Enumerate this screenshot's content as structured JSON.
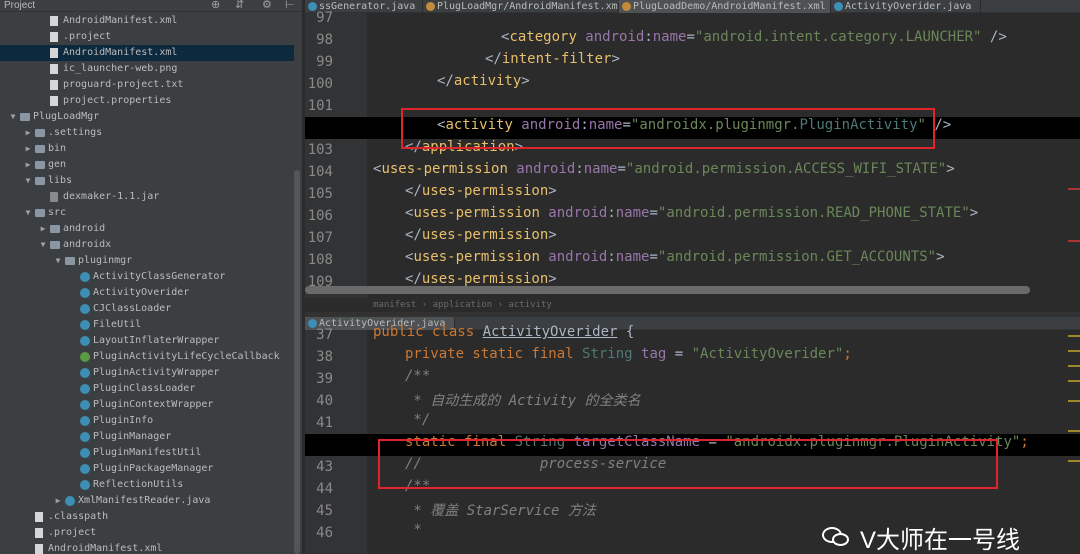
{
  "sidebar": {
    "header": "Project",
    "rows": [
      {
        "label": "AndroidManifest.xml",
        "indent": 3,
        "icon": "xml-file-icon",
        "arrow": ""
      },
      {
        "label": ".project",
        "indent": 3,
        "icon": "file-icon",
        "arrow": ""
      },
      {
        "label": "AndroidManifest.xml",
        "indent": 3,
        "icon": "xml-file-icon",
        "arrow": "",
        "selected": true
      },
      {
        "label": "ic_launcher-web.png",
        "indent": 3,
        "icon": "image-file-icon",
        "arrow": ""
      },
      {
        "label": "proguard-project.txt",
        "indent": 3,
        "icon": "text-file-icon",
        "arrow": ""
      },
      {
        "label": "project.properties",
        "indent": 3,
        "icon": "properties-file-icon",
        "arrow": ""
      },
      {
        "label": "PlugLoadMgr",
        "indent": 1,
        "icon": "folder-icon",
        "arrow": "▼"
      },
      {
        "label": ".settings",
        "indent": 2,
        "icon": "folder-icon",
        "arrow": "▶"
      },
      {
        "label": "bin",
        "indent": 2,
        "icon": "folder-icon",
        "arrow": "▶"
      },
      {
        "label": "gen",
        "indent": 2,
        "icon": "folder-icon",
        "arrow": "▶"
      },
      {
        "label": "libs",
        "indent": 2,
        "icon": "folder-icon",
        "arrow": "▼"
      },
      {
        "label": "dexmaker-1.1.jar",
        "indent": 3,
        "icon": "jar-icon",
        "arrow": ""
      },
      {
        "label": "src",
        "indent": 2,
        "icon": "folder-icon",
        "arrow": "▼"
      },
      {
        "label": "android",
        "indent": 3,
        "icon": "package-icon",
        "arrow": "▶"
      },
      {
        "label": "androidx",
        "indent": 3,
        "icon": "package-icon",
        "arrow": "▼"
      },
      {
        "label": "pluginmgr",
        "indent": 4,
        "icon": "package-icon",
        "arrow": "▼"
      },
      {
        "label": "ActivityClassGenerator",
        "indent": 5,
        "icon": "class-icon",
        "arrow": ""
      },
      {
        "label": "ActivityOverider",
        "indent": 5,
        "icon": "class-icon",
        "arrow": ""
      },
      {
        "label": "CJClassLoader",
        "indent": 5,
        "icon": "class-icon",
        "arrow": ""
      },
      {
        "label": "FileUtil",
        "indent": 5,
        "icon": "class-icon",
        "arrow": ""
      },
      {
        "label": "LayoutInflaterWrapper",
        "indent": 5,
        "icon": "class-icon",
        "arrow": ""
      },
      {
        "label": "PluginActivityLifeCycleCallback",
        "indent": 5,
        "icon": "interface-icon",
        "arrow": ""
      },
      {
        "label": "PluginActivityWrapper",
        "indent": 5,
        "icon": "class-icon",
        "arrow": ""
      },
      {
        "label": "PluginClassLoader",
        "indent": 5,
        "icon": "class-icon",
        "arrow": ""
      },
      {
        "label": "PluginContextWrapper",
        "indent": 5,
        "icon": "class-icon",
        "arrow": ""
      },
      {
        "label": "PluginInfo",
        "indent": 5,
        "icon": "class-icon",
        "arrow": ""
      },
      {
        "label": "PluginManager",
        "indent": 5,
        "icon": "class-icon",
        "arrow": ""
      },
      {
        "label": "PluginManifestUtil",
        "indent": 5,
        "icon": "class-icon",
        "arrow": ""
      },
      {
        "label": "PluginPackageManager",
        "indent": 5,
        "icon": "class-icon",
        "arrow": ""
      },
      {
        "label": "ReflectionUtils",
        "indent": 5,
        "icon": "class-icon",
        "arrow": ""
      },
      {
        "label": "XmlManifestReader.java",
        "indent": 4,
        "icon": "class-icon",
        "arrow": "▶"
      },
      {
        "label": ".classpath",
        "indent": 2,
        "icon": "file-icon",
        "arrow": ""
      },
      {
        "label": ".project",
        "indent": 2,
        "icon": "file-icon",
        "arrow": ""
      },
      {
        "label": "AndroidManifest.xml",
        "indent": 2,
        "icon": "xml-file-icon",
        "arrow": ""
      }
    ]
  },
  "editor_top": {
    "tabs": [
      {
        "label": "ssGenerator.java",
        "active": false
      },
      {
        "label": "PlugLoadMgr/AndroidManifest.xml",
        "active": false
      },
      {
        "label": "PlugLoadDemo/AndroidManifest.xml",
        "active": true
      },
      {
        "label": "ActivityOverider.java",
        "active": false
      }
    ],
    "lines": [
      {
        "n": "97",
        "indent": 0,
        "parts": []
      },
      {
        "n": "98",
        "indent": 8,
        "parts": [
          [
            "tx",
            "<"
          ],
          [
            "tg",
            "category "
          ],
          [
            "at",
            "android"
          ],
          [
            "tx",
            ":"
          ],
          [
            "fl",
            "name"
          ],
          [
            "tx",
            "="
          ],
          [
            "st",
            "\"android.intent.category.LAUNCHER\""
          ],
          [
            "tx",
            " />"
          ]
        ]
      },
      {
        "n": "99",
        "indent": 7,
        "parts": [
          [
            "tx",
            "</"
          ],
          [
            "tg",
            "intent-filter"
          ],
          [
            "tx",
            ">"
          ]
        ]
      },
      {
        "n": "100",
        "indent": 4,
        "parts": [
          [
            "tx",
            "</"
          ],
          [
            "tg",
            "activity"
          ],
          [
            "tx",
            ">"
          ]
        ]
      },
      {
        "n": "101",
        "indent": 0,
        "parts": []
      },
      {
        "n": "102",
        "indent": 4,
        "cur": true,
        "parts": [
          [
            "tx",
            "<"
          ],
          [
            "tg",
            "activity "
          ],
          [
            "at",
            "android"
          ],
          [
            "tx",
            ":"
          ],
          [
            "fl",
            "name"
          ],
          [
            "tx",
            "="
          ],
          [
            "st",
            "\"androidx."
          ],
          [
            "st",
            "pluginmgr"
          ],
          [
            "st",
            "."
          ],
          [
            "tp",
            "PluginActivity"
          ],
          [
            "st",
            "\""
          ],
          [
            "tx",
            " />"
          ]
        ]
      },
      {
        "n": "103",
        "indent": 2,
        "parts": [
          [
            "tx",
            "</"
          ],
          [
            "tg",
            "application"
          ],
          [
            "tx",
            ">"
          ]
        ]
      },
      {
        "n": "104",
        "indent": 0,
        "parts": [
          [
            "tx",
            "<"
          ],
          [
            "tg",
            "uses-permission "
          ],
          [
            "at",
            "android"
          ],
          [
            "tx",
            ":"
          ],
          [
            "fl",
            "name"
          ],
          [
            "tx",
            "="
          ],
          [
            "st",
            "\"android.permission.ACCESS_WIFI_STATE\""
          ],
          [
            "tx",
            ">"
          ]
        ]
      },
      {
        "n": "105",
        "indent": 2,
        "parts": [
          [
            "tx",
            "</"
          ],
          [
            "tg",
            "uses-permission"
          ],
          [
            "tx",
            ">"
          ]
        ]
      },
      {
        "n": "106",
        "indent": 2,
        "parts": [
          [
            "tx",
            "<"
          ],
          [
            "tg",
            "uses-permission "
          ],
          [
            "at",
            "android"
          ],
          [
            "tx",
            ":"
          ],
          [
            "fl",
            "name"
          ],
          [
            "tx",
            "="
          ],
          [
            "st",
            "\"android.permission.READ_PHONE_STATE\""
          ],
          [
            "tx",
            ">"
          ]
        ]
      },
      {
        "n": "107",
        "indent": 2,
        "parts": [
          [
            "tx",
            "</"
          ],
          [
            "tg",
            "uses-permission"
          ],
          [
            "tx",
            ">"
          ]
        ]
      },
      {
        "n": "108",
        "indent": 2,
        "parts": [
          [
            "tx",
            "<"
          ],
          [
            "tg",
            "uses-permission "
          ],
          [
            "at",
            "android"
          ],
          [
            "tx",
            ":"
          ],
          [
            "fl",
            "name"
          ],
          [
            "tx",
            "="
          ],
          [
            "st",
            "\"android.permission.GET_ACCOUNTS\""
          ],
          [
            "tx",
            ">"
          ]
        ]
      },
      {
        "n": "109",
        "indent": 2,
        "parts": [
          [
            "tx",
            "</"
          ],
          [
            "tg",
            "uses-permission"
          ],
          [
            "tx",
            ">"
          ]
        ]
      }
    ]
  },
  "breadcrumb": "manifest › application › activity",
  "editor_bottom": {
    "tabs": [
      {
        "label": "ActivityOverider.java",
        "active": true
      }
    ],
    "lines": [
      {
        "n": "37",
        "indent": 0,
        "parts": [
          [
            "kw",
            "public class "
          ],
          [
            "cls",
            "ActivityOverider"
          ],
          [
            "tx",
            " {"
          ]
        ]
      },
      {
        "n": "38",
        "indent": 2,
        "parts": [
          [
            "kw",
            "private static final "
          ],
          [
            "tp",
            "String "
          ],
          [
            "fl",
            "tag"
          ],
          [
            "tx",
            " = "
          ],
          [
            "st",
            "\"ActivityOverider\""
          ],
          [
            "kw",
            ";"
          ]
        ]
      },
      {
        "n": "39",
        "indent": 2,
        "parts": [
          [
            "cm",
            "/**"
          ]
        ]
      },
      {
        "n": "40",
        "indent": 2,
        "parts": [
          [
            "cm",
            " * 自动生成的 Activity 的全类名"
          ]
        ]
      },
      {
        "n": "41",
        "indent": 2,
        "parts": [
          [
            "cm",
            " */"
          ]
        ]
      },
      {
        "n": "42",
        "indent": 2,
        "cur": true,
        "parts": [
          [
            "kw",
            "static final "
          ],
          [
            "tp",
            "String "
          ],
          [
            "fl",
            "targetClassName"
          ],
          [
            "tx",
            " = "
          ],
          [
            "st",
            "\"androidx."
          ],
          [
            "st",
            "pluginmgr"
          ],
          [
            "st",
            ".PluginActivity\""
          ],
          [
            "kw",
            ";"
          ]
        ]
      },
      {
        "n": "43",
        "indent": 2,
        "parts": [
          [
            "cm",
            "//              process-service"
          ]
        ]
      },
      {
        "n": "44",
        "indent": 2,
        "parts": [
          [
            "cm",
            "/**"
          ]
        ]
      },
      {
        "n": "45",
        "indent": 2,
        "parts": [
          [
            "cm",
            " * 覆盖 StarService 方法"
          ]
        ]
      },
      {
        "n": "46",
        "indent": 2,
        "parts": [
          [
            "cm",
            " *"
          ]
        ]
      }
    ]
  },
  "watermark": "V大师在一号线",
  "colors": {
    "highlight_box": "#e0242c",
    "tag": "#e8bf6a",
    "string": "#6a8759",
    "keyword": "#cc7832"
  }
}
